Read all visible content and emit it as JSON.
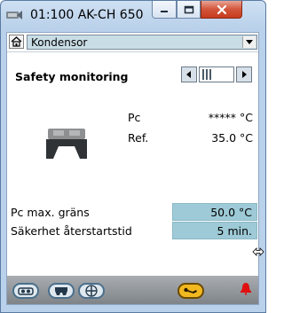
{
  "window": {
    "title": "01:100 AK-CH 650",
    "icon": "wrench-app-icon",
    "controls": [
      "minimize-icon",
      "maximize-icon",
      "close-icon"
    ]
  },
  "nav": {
    "home_icon": "home-icon",
    "selected_view": "Kondensor"
  },
  "section": {
    "title": "Safety monitoring",
    "stepper_icons": [
      "arrow-left-icon",
      "arrow-right-icon"
    ]
  },
  "readings": [
    {
      "label": "Pc",
      "value": "***** °C"
    },
    {
      "label": "Ref.",
      "value": "35.0 °C"
    }
  ],
  "parameters": [
    {
      "label": "Pc max. gräns",
      "value": "50.0 °C"
    },
    {
      "label": "Säkerhet återstartstid",
      "value": "5 min."
    }
  ],
  "toolbar": {
    "buttons": [
      "compressor-icon",
      "condenser-icon",
      "fan-icon",
      "service-wrench-icon"
    ],
    "alarm_icon": "alarm-bell-icon"
  },
  "colors": {
    "field_bg": "#9dcad6",
    "combo_bg": "#c9dde6",
    "close_button": "#c63b1e",
    "toolbar": "#8a8e92",
    "alarm": "#e01010",
    "service_button": "#f2b81f"
  }
}
